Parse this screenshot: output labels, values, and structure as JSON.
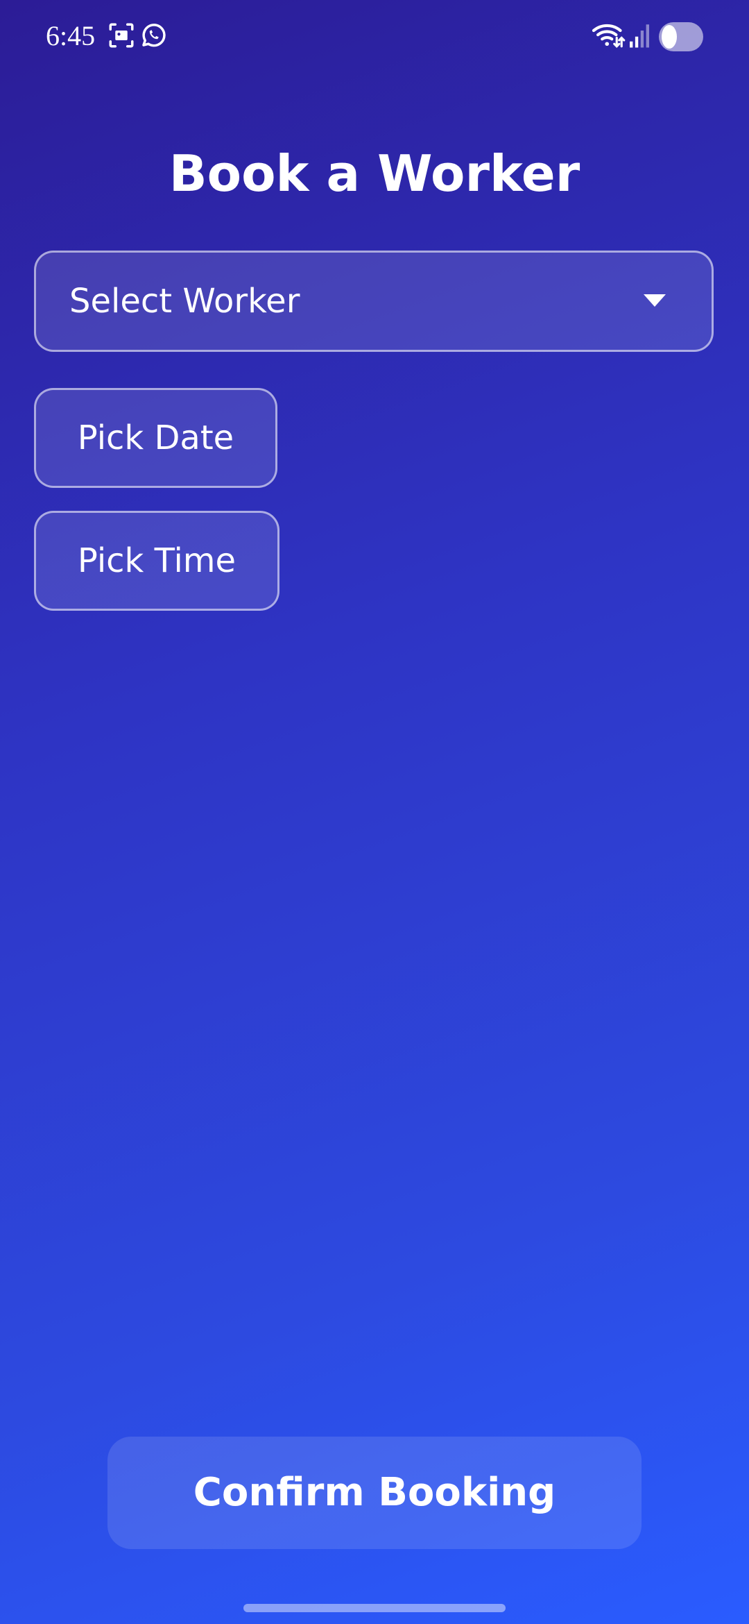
{
  "status_bar": {
    "time": "6:45",
    "icons": [
      "screenshot-icon",
      "whatsapp-icon",
      "wifi-icon",
      "signal-icon",
      "battery-icon"
    ]
  },
  "page": {
    "title": "Book a Worker"
  },
  "worker_select": {
    "label": "Select Worker"
  },
  "pick_date": {
    "label": "Pick Date"
  },
  "pick_time": {
    "label": "Pick Time"
  },
  "confirm": {
    "label": "Confirm Booking"
  },
  "colors": {
    "gradient_top": "#2c1c96",
    "gradient_bottom": "#2a5cff",
    "text": "#ffffff"
  }
}
